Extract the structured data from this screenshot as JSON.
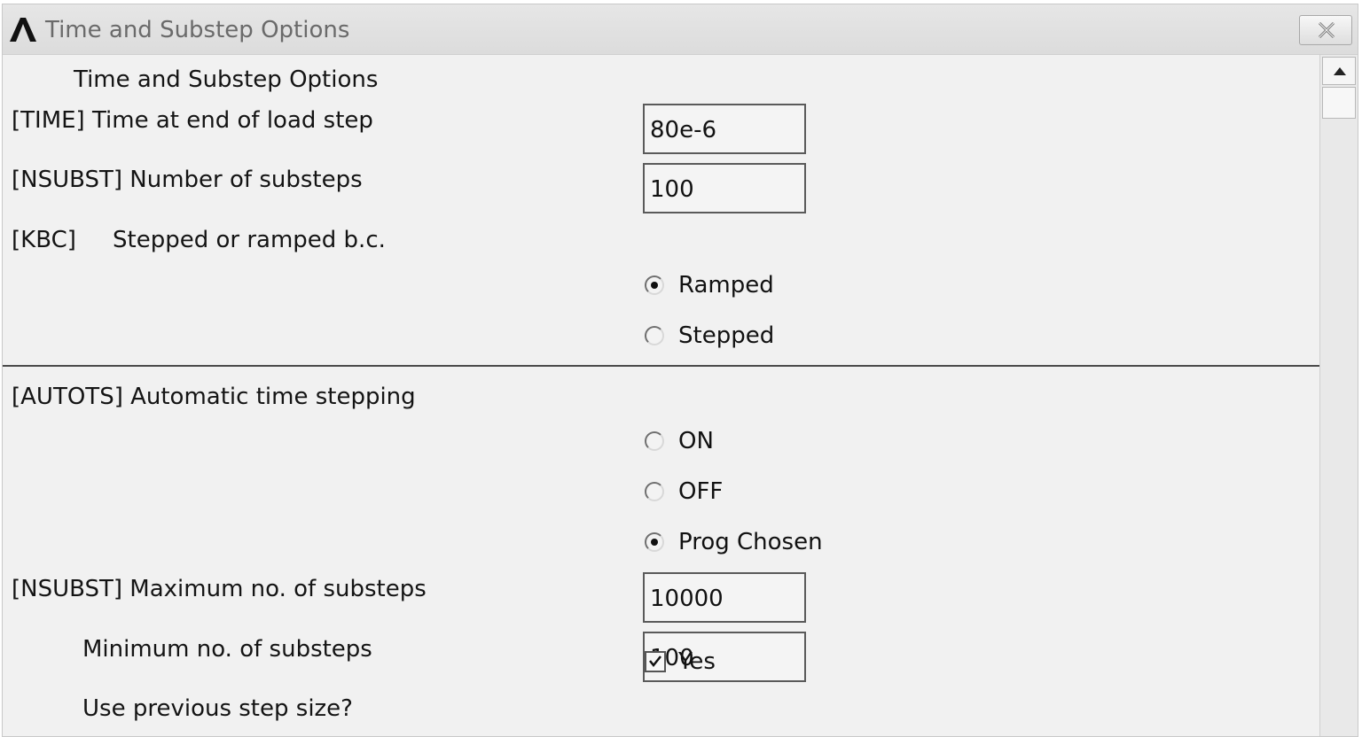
{
  "window": {
    "title": "Time and Substep Options",
    "close_icon": "close-icon"
  },
  "header": {
    "section_title": "Time and Substep Options"
  },
  "time": {
    "label": "[TIME]  Time at end of load step",
    "value": "80e-6"
  },
  "nsubst": {
    "label": "[NSUBST]  Number of substeps",
    "value": "100"
  },
  "kbc": {
    "label_code": "[KBC]",
    "label_text": "Stepped or ramped b.c.",
    "options": [
      {
        "label": "Ramped",
        "selected": true
      },
      {
        "label": "Stepped",
        "selected": false
      }
    ]
  },
  "autots": {
    "label": "[AUTOTS] Automatic time stepping",
    "options": [
      {
        "label": "ON",
        "selected": false
      },
      {
        "label": "OFF",
        "selected": false
      },
      {
        "label": "Prog Chosen",
        "selected": true
      }
    ]
  },
  "max_substeps": {
    "label": "[NSUBST] Maximum no. of substeps",
    "value": "10000"
  },
  "min_substeps": {
    "label": "Minimum no. of substeps",
    "value": "100"
  },
  "prev_step": {
    "label": "Use previous step size?",
    "checkbox_label": "Yes",
    "checked": true
  },
  "colors": {
    "window_bg": "#f1f1f1",
    "titlebar_bg": "#e2e2e2",
    "title_text": "#6a6a6a",
    "divider": "#4a4a4a"
  }
}
